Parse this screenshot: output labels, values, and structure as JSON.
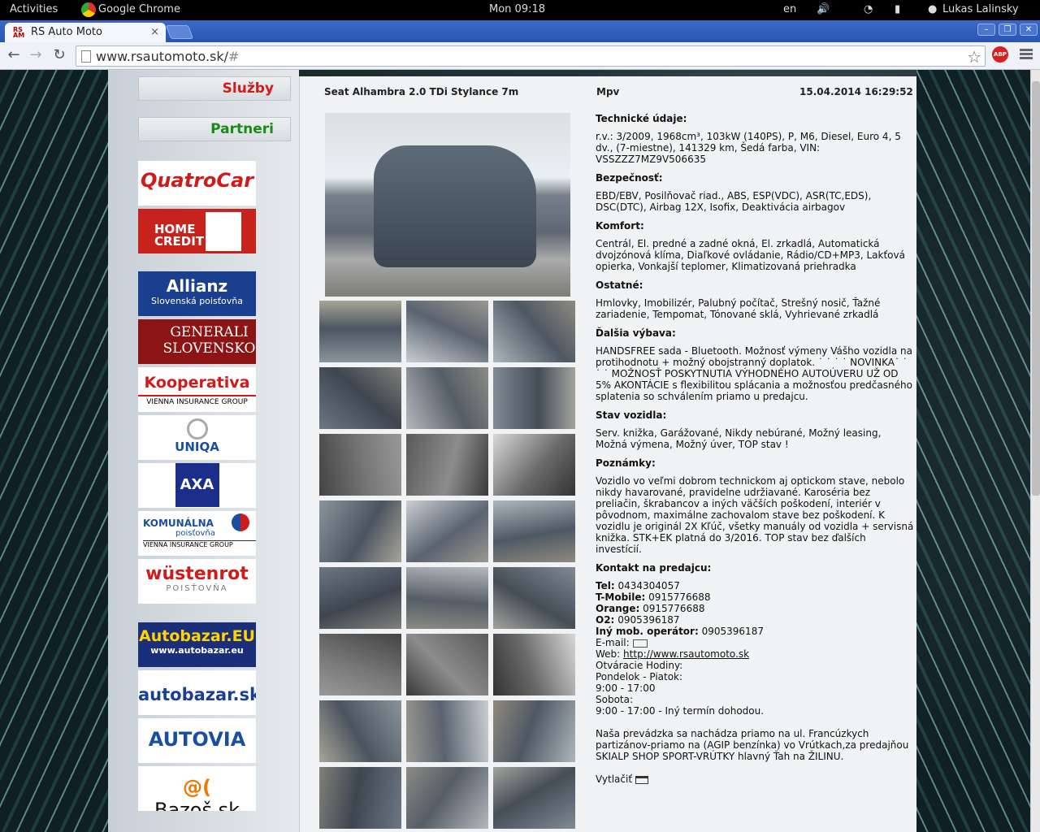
{
  "system_bar": {
    "activities": "Activities",
    "app": "Google Chrome",
    "clock": "Mon 09:18",
    "lang": "en",
    "user": "Lukas Lalinsky"
  },
  "browser": {
    "tab_title": "RS Auto Moto",
    "tab_close": "×",
    "url_host": "www.rsautomoto.sk/",
    "url_hash": "#",
    "abp": "ABP"
  },
  "sidebar": {
    "buttons": [
      {
        "label": "Služby",
        "color": "#d11a1a"
      },
      {
        "label": "Partneri",
        "color": "#1a8a1a"
      }
    ],
    "banners": [
      "QuatroCar",
      "HOME CREDIT",
      "Allianz",
      "Slovenská poisťovňa",
      "GENERALI",
      "SLOVENSKO",
      "Kooperativa",
      "VIENNA INSURANCE GROUP",
      "UNIQA",
      "AXA",
      "KOMUNÁLNA",
      "poisťovňa",
      "VIENNA INSURANCE GROUP",
      "wüstenrot",
      "POISŤOVŇA",
      "Autobazar.EU",
      "www.autobazar.eu",
      "autobazar.sk",
      "AUTOVIA",
      "Bazoš.sk"
    ]
  },
  "listing": {
    "title": "Seat Alhambra 2.0 TDi Stylance 7m",
    "category": "Mpv",
    "datetime": "15.04.2014 16:29:52",
    "sections": [
      {
        "h": "Technické údaje:",
        "t": "r.v.: 3/2009, 1968cm³, 103kW (140PS), P, M6, Diesel, Euro 4, 5 dv., (7-miestne), 141329 km, Šedá farba, VIN: VSSZZZ7MZ9V506635"
      },
      {
        "h": "Bezpečnosť:",
        "t": "EBD/EBV, Posilňovač riad., ABS, ESP(VDC), ASR(TC,EDS), DSC(DTC), Airbag 12X, Isofix, Deaktivácia airbagov"
      },
      {
        "h": "Komfort:",
        "t": "Centrál, El. predné a zadné okná, El. zrkadlá, Automatická dvojzónová klíma, Diaľkové ovládanie, Rádio/CD+MP3, Lakťová opierka, Vonkajší teplomer, Klimatizovaná priehradka"
      },
      {
        "h": "Ostatné:",
        "t": "Hmlovky, Imobilizér, Palubný počítač, Strešný nosič, Ťažné zariadenie, Tempomat, Tónované sklá, Vyhrievané zrkadlá"
      },
      {
        "h": "Ďalšia výbava:",
        "t": "HANDSFREE sada - Bluetooth. Možnosť výmeny Vášho vozidla na protihodnotu + možný obojstranný doplatok. ˙ ˙ ˙ ˙ NOVINKA˙ ˙ ˙ ˙ MOŽNOSŤ POSKYTNUTIA VÝHODNÉHO AUTOÚVERU UŽ OD 5% AKONTÁCIE s flexibilitou splácania a možnosťou predčasného splatenia so schválením priamo u predajcu."
      },
      {
        "h": "Stav vozidla:",
        "t": "Serv. knižka, Garážované, Nikdy nebúrané, Možný leasing, Možná výmena, Možný úver, TOP stav !"
      },
      {
        "h": "Poznámky:",
        "t": "Vozidlo vo veľmi dobrom technickom aj optickom stave, nebolo nikdy havarované, pravidelne udržiavané. Karoséria bez preliačin, škrabancov a iných väčších poškodení, interiér v pôvodnom, maximálne zachovalom stave bez poškodení. K vozidlu je originál 2X Kľúč, všetky manuály od vozidla + servisná knižka. STK+EK platná do 3/2016. TOP stav bez ďalších investícií."
      }
    ],
    "contact": {
      "heading": "Kontakt na predajcu:",
      "tel_label": "Tel:",
      "tel": "0434304057",
      "tmobile_label": "T-Mobile:",
      "tmobile": "0915776688",
      "orange_label": "Orange:",
      "orange": "0915776688",
      "o2_label": "O2:",
      "o2": "0905396187",
      "other_label": "Iný mob. operátor:",
      "other": "0905396187",
      "email_label": "E-mail:",
      "web_label": "Web:",
      "web": "http://www.rsautomoto.sk",
      "hours_label": "Otváracie Hodiny:",
      "days1": "Pondelok - Piatok:",
      "hours1": "9:00 - 17:00",
      "days2": "Sobota:",
      "hours2": "9:00 - 17:00 - Iný termín dohodou.",
      "address": "Naša prevádzka sa nachádza priamo na ul. Francúzkych partizánov-priamo na (AGIP benzínka) vo Vrútkach,za predajňou SKIALP SHOP SPORT-VRÚTKY hlavný Ťah na ŽILINU.",
      "print": "Vytlačiť"
    }
  }
}
